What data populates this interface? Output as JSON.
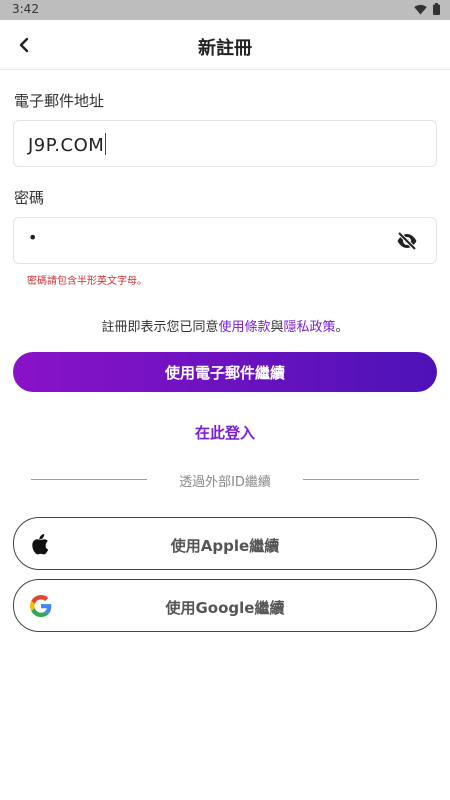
{
  "status": {
    "time": "3:42"
  },
  "header": {
    "title": "新註冊"
  },
  "email": {
    "label": "電子郵件地址",
    "value": "J9P.COM"
  },
  "password": {
    "label": "密碼",
    "value": "•",
    "error": "密碼請包含半形英文字母。"
  },
  "terms": {
    "prefix": "註冊即表示您已同意",
    "terms_link": "使用條款",
    "joiner": "與",
    "privacy_link": "隱私政策",
    "suffix": "。"
  },
  "buttons": {
    "email_continue": "使用電子郵件繼續",
    "login": "在此登入",
    "apple": "使用Apple繼續",
    "google": "使用Google繼續"
  },
  "divider": {
    "text": "透過外部ID繼續"
  },
  "colors": {
    "accent": "#7b1fd6",
    "gradient_start": "#8a12c8",
    "gradient_end": "#4e12b8",
    "error": "#d32f2f"
  },
  "icons": {
    "back": "back-arrow-icon",
    "eye": "eye-off-icon",
    "apple": "apple-icon",
    "google": "google-icon"
  }
}
